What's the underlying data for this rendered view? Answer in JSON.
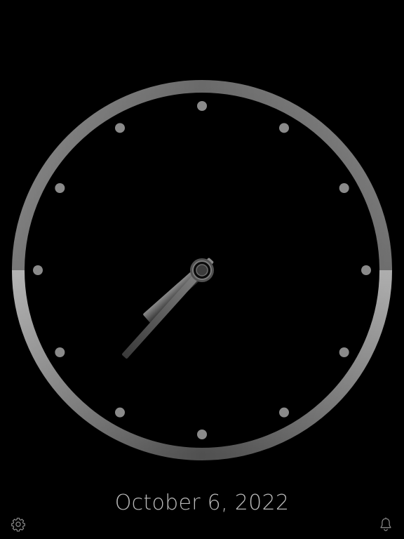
{
  "clock": {
    "date_label": "October 6, 2022",
    "time": {
      "hours": 7,
      "minutes": 37
    },
    "hour_markers": 12
  },
  "toolbar": {
    "settings_icon": "gear-icon",
    "alarm_icon": "bell-icon"
  },
  "colors": {
    "background": "#000000",
    "bezel_light": "#8c8c8c",
    "bezel_dark": "#3a3a3a",
    "marker": "#8a8a8a",
    "hand": "#6e6e6e",
    "date_text": "#b9b9b9",
    "icon": "#8e8e8e"
  }
}
